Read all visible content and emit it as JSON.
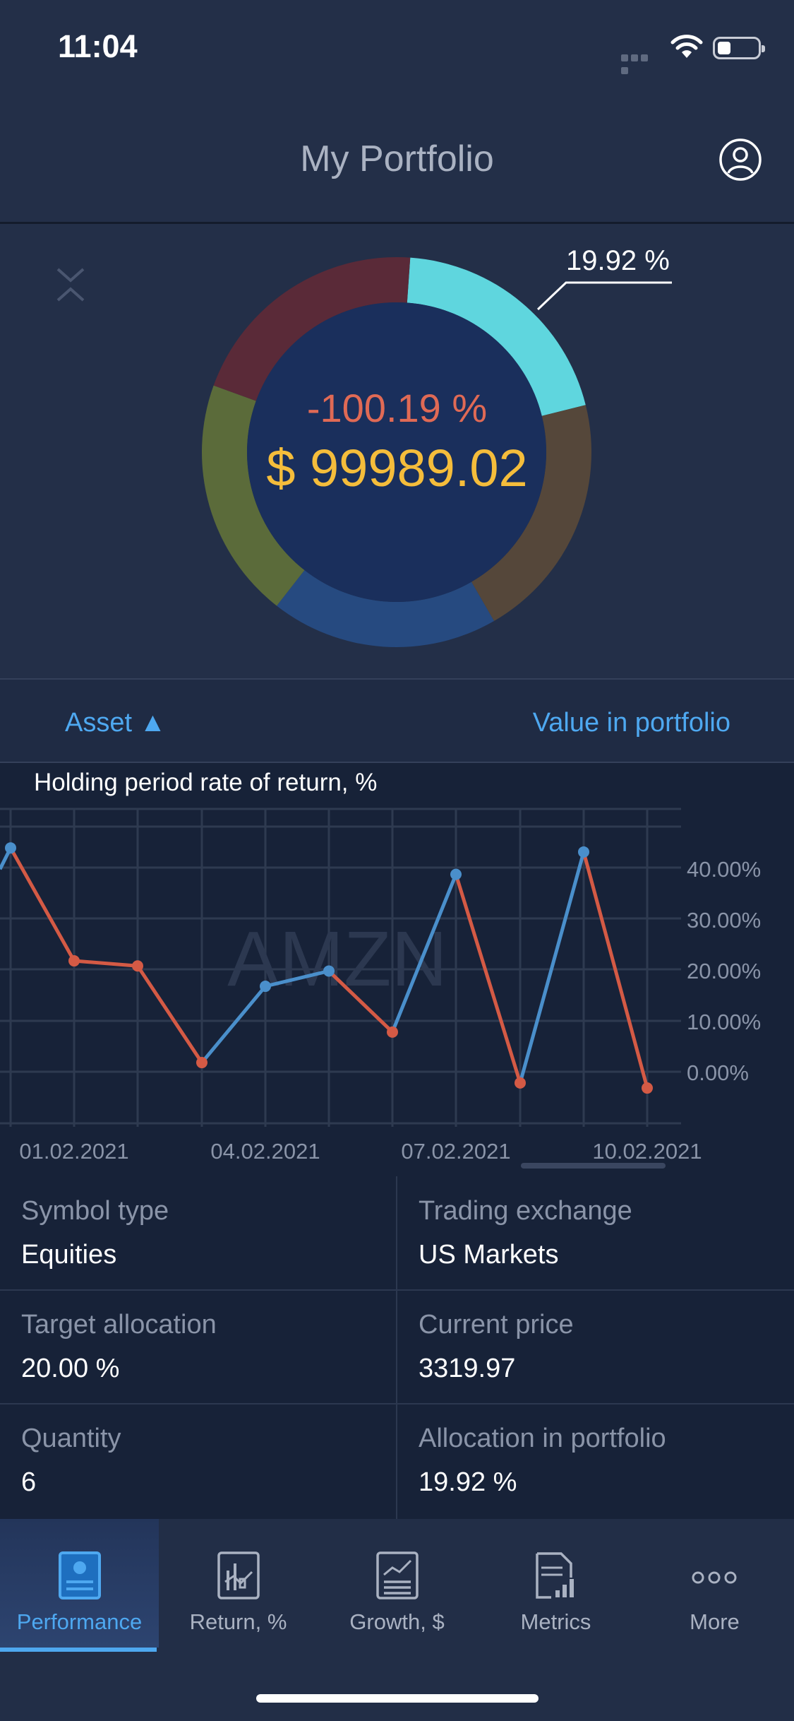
{
  "status_bar": {
    "time": "11:04"
  },
  "header": {
    "title": "My Portfolio"
  },
  "donut": {
    "center_return": "-100.19 %",
    "center_value": "$ 99989.02",
    "callout_label": "19.92 %",
    "segment_colors": [
      "#5fd6de",
      "#55473a",
      "#264a80",
      "#5b6b3a",
      "#5a2a38"
    ]
  },
  "sort_bar": {
    "asset_label": "Asset ▲",
    "value_label": "Value in portfolio"
  },
  "chart_section": {
    "title": "Holding period rate of return, %",
    "watermark": "AMZN"
  },
  "chart_data": {
    "type": "line",
    "title": "Holding period rate of return, %",
    "watermark": "AMZN",
    "x_tick_labels": [
      "01.02.2021",
      "04.02.2021",
      "07.02.2021",
      "10.02.2021"
    ],
    "y_tick_labels": [
      "40.00%",
      "30.00%",
      "20.00%",
      "10.00%",
      "0.00%"
    ],
    "ylim": [
      -10,
      50
    ],
    "grid": true,
    "colors": {
      "up": "#4a8fcb",
      "down": "#d45a45"
    },
    "x": [
      "31.01.2021",
      "01.02.2021",
      "02.02.2021",
      "03.02.2021",
      "04.02.2021",
      "05.02.2021",
      "06.02.2021",
      "07.02.2021",
      "08.02.2021",
      "09.02.2021",
      "10.02.2021"
    ],
    "values": [
      44.0,
      21.8,
      20.8,
      1.8,
      16.8,
      19.8,
      7.8,
      38.8,
      -2.2,
      43.2,
      -3.2
    ]
  },
  "details": {
    "symbol_type": {
      "label": "Symbol type",
      "value": "Equities"
    },
    "trading_exchange": {
      "label": "Trading exchange",
      "value": "US Markets"
    },
    "target_allocation": {
      "label": "Target allocation",
      "value": "20.00 %"
    },
    "current_price": {
      "label": "Current price",
      "value": "3319.97"
    },
    "quantity": {
      "label": "Quantity",
      "value": "6"
    },
    "allocation_in_portfolio": {
      "label": "Allocation in portfolio",
      "value": "19.92 %"
    }
  },
  "tabs": [
    {
      "label": "Performance",
      "icon": "performance-icon",
      "active": true
    },
    {
      "label": "Return, %",
      "icon": "return-icon",
      "active": false
    },
    {
      "label": "Growth, $",
      "icon": "growth-icon",
      "active": false
    },
    {
      "label": "Metrics",
      "icon": "metrics-icon",
      "active": false
    },
    {
      "label": "More",
      "icon": "more-icon",
      "active": false
    }
  ],
  "accent_color": "#4ea8f0"
}
